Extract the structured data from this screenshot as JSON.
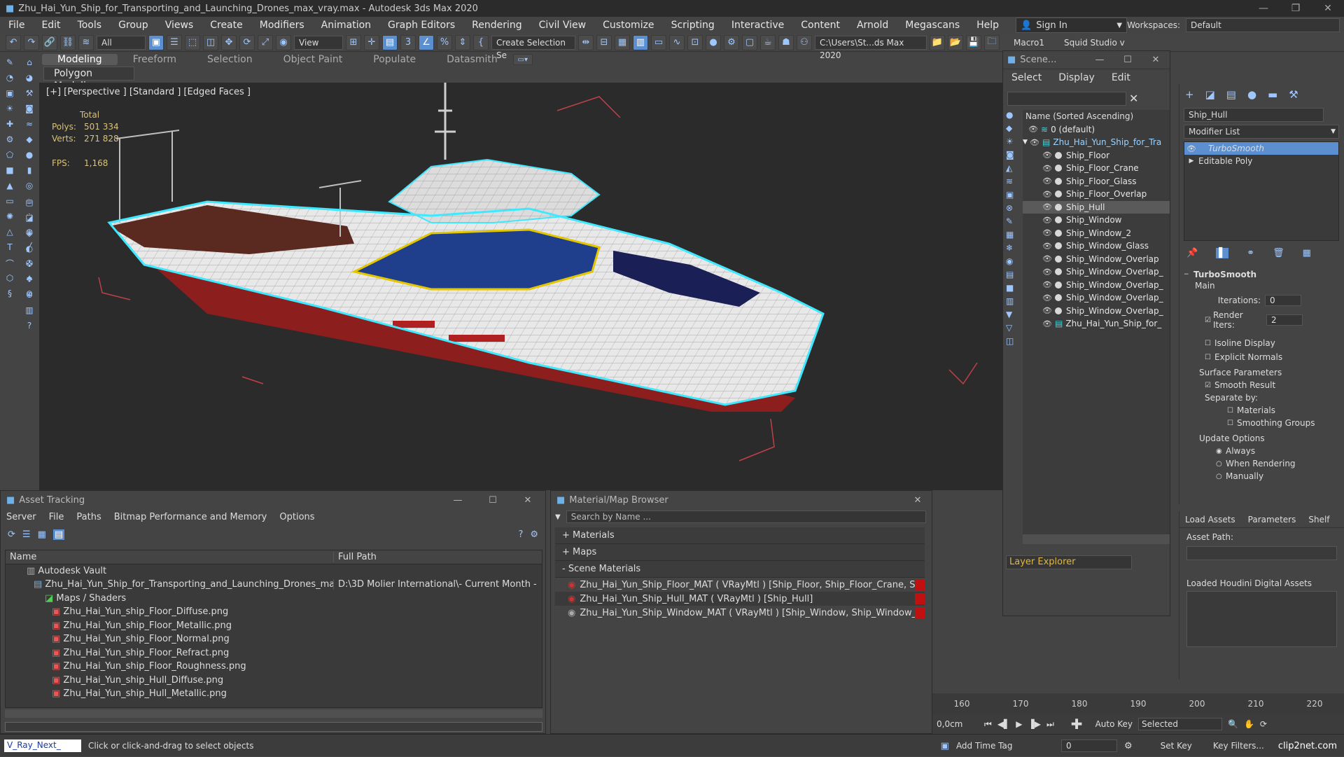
{
  "titlebar": {
    "title": "Zhu_Hai_Yun_Ship_for_Transporting_and_Launching_Drones_max_vray.max - Autodesk 3ds Max 2020",
    "min": "—",
    "max": "❐",
    "close": "✕"
  },
  "menu": [
    "File",
    "Edit",
    "Tools",
    "Group",
    "Views",
    "Create",
    "Modifiers",
    "Animation",
    "Graph Editors",
    "Rendering",
    "Civil View",
    "Customize",
    "Scripting",
    "Interactive",
    "Content",
    "Arnold",
    "Megascans",
    "Help"
  ],
  "signin": "Sign In",
  "workspace": {
    "label": "Workspaces:",
    "value": "Default"
  },
  "toolbar": {
    "selection_filter": "All",
    "ref_coord": "View",
    "create_sel_set": "Create Selection Se",
    "path": "C:\\Users\\St...ds Max 2020",
    "macro1": "Macro1",
    "squid": "Squid Studio v"
  },
  "ribbon": {
    "tabs": [
      "Modeling",
      "Freeform",
      "Selection",
      "Object Paint",
      "Populate",
      "Datasmith"
    ],
    "active": "Modeling",
    "sub": "Polygon Modeling"
  },
  "viewport": {
    "label": "[+] [Perspective ] [Standard ] [Edged Faces ]",
    "stats": {
      "total_label": "Total",
      "polys_label": "Polys:",
      "polys": "501 334",
      "verts_label": "Verts:",
      "verts": "271 828",
      "fps_label": "FPS:",
      "fps": "1,168"
    }
  },
  "scene_explorer": {
    "title": "Scene...",
    "menu": [
      "Select",
      "Display",
      "Edit"
    ],
    "column": "Name (Sorted Ascending)",
    "items": [
      {
        "name": "0 (default)",
        "level": 0
      },
      {
        "name": "Zhu_Hai_Yun_Ship_for_Tra",
        "level": 1
      },
      {
        "name": "Ship_Floor",
        "level": 2
      },
      {
        "name": "Ship_Floor_Crane",
        "level": 2
      },
      {
        "name": "Ship_Floor_Glass",
        "level": 2
      },
      {
        "name": "Ship_Floor_Overlap",
        "level": 2
      },
      {
        "name": "Ship_Hull",
        "level": 2,
        "selected": true
      },
      {
        "name": "Ship_Window",
        "level": 2
      },
      {
        "name": "Ship_Window_2",
        "level": 2
      },
      {
        "name": "Ship_Window_Glass",
        "level": 2
      },
      {
        "name": "Ship_Window_Overlap",
        "level": 2
      },
      {
        "name": "Ship_Window_Overlap_",
        "level": 2
      },
      {
        "name": "Ship_Window_Overlap_",
        "level": 2
      },
      {
        "name": "Ship_Window_Overlap_",
        "level": 2
      },
      {
        "name": "Ship_Window_Overlap_",
        "level": 2
      },
      {
        "name": "Zhu_Hai_Yun_Ship_for_",
        "level": 2
      }
    ],
    "footer": "Layer Explorer"
  },
  "command_panel": {
    "object_name": "Ship_Hull",
    "modifier_list": "Modifier List",
    "stack": [
      "TurboSmooth",
      "Editable Poly"
    ],
    "rollout_title": "TurboSmooth",
    "main_label": "Main",
    "iterations_label": "Iterations:",
    "iterations": "0",
    "render_iters_label": "Render Iters:",
    "render_iters": "2",
    "isoline": "Isoline Display",
    "explicit": "Explicit Normals",
    "surface_label": "Surface Parameters",
    "smooth_result": "Smooth Result",
    "separate_by": "Separate by:",
    "materials": "Materials",
    "smoothing_groups": "Smoothing Groups",
    "update_label": "Update Options",
    "always": "Always",
    "when_rendering": "When Rendering",
    "manually": "Manually",
    "tabs": [
      "Load Assets",
      "Parameters",
      "Shelf"
    ],
    "asset_path": "Asset Path:",
    "houdini": "Loaded Houdini Digital Assets"
  },
  "asset_tracking": {
    "title": "Asset Tracking",
    "menu": [
      "Server",
      "File",
      "Paths",
      "Bitmap Performance and Memory",
      "Options"
    ],
    "col_name": "Name",
    "col_path": "Full Path",
    "rows": [
      {
        "name": "Autodesk Vault",
        "path": "",
        "indent": 1
      },
      {
        "name": "Zhu_Hai_Yun_Ship_for_Transporting_and_Launching_Drones_ma...",
        "path": "D:\\3D Molier International\\- Current Month -",
        "indent": 2
      },
      {
        "name": "Maps / Shaders",
        "path": "",
        "indent": 3
      },
      {
        "name": "Zhu_Hai_Yun_ship_Floor_Diffuse.png",
        "path": "",
        "indent": 4
      },
      {
        "name": "Zhu_Hai_Yun_ship_Floor_Metallic.png",
        "path": "",
        "indent": 4
      },
      {
        "name": "Zhu_Hai_Yun_ship_Floor_Normal.png",
        "path": "",
        "indent": 4
      },
      {
        "name": "Zhu_Hai_Yun_ship_Floor_Refract.png",
        "path": "",
        "indent": 4
      },
      {
        "name": "Zhu_Hai_Yun_ship_Floor_Roughness.png",
        "path": "",
        "indent": 4
      },
      {
        "name": "Zhu_Hai_Yun_ship_Hull_Diffuse.png",
        "path": "",
        "indent": 4
      },
      {
        "name": "Zhu_Hai_Yun_ship_Hull_Metallic.png",
        "path": "",
        "indent": 4
      }
    ]
  },
  "material_browser": {
    "title": "Material/Map Browser",
    "search_placeholder": "Search by Name ...",
    "sections": [
      "+ Materials",
      "+ Maps",
      "- Scene Materials"
    ],
    "materials": [
      "Zhu_Hai_Yun_Ship_Floor_MAT  ( VRayMtl ) [Ship_Floor, Ship_Floor_Crane, Ship...",
      "Zhu_Hai_Yun_Ship_Hull_MAT  ( VRayMtl ) [Ship_Hull]",
      "Zhu_Hai_Yun_Ship_Window_MAT  ( VRayMtl ) [Ship_Window, Ship_Window_2..."
    ]
  },
  "timeline": {
    "ticks": [
      "160",
      "170",
      "180",
      "190",
      "200",
      "210",
      "220"
    ],
    "unit": "0,0cm"
  },
  "status": {
    "script": "V_Ray_Next_",
    "prompt": "Click or click-and-drag to select objects",
    "add_time_tag": "Add Time Tag",
    "auto_key": "Auto Key",
    "selected": "Selected",
    "set_key": "Set Key",
    "key_filters": "Key Filters...",
    "frame": "0",
    "watermark": "clip2net.com"
  },
  "colors": {
    "accent": "#5b8fcf",
    "wire_select": "#3ee9ff",
    "hull_red": "#8c1e1e",
    "deck_blue": "#1f3f8c"
  }
}
